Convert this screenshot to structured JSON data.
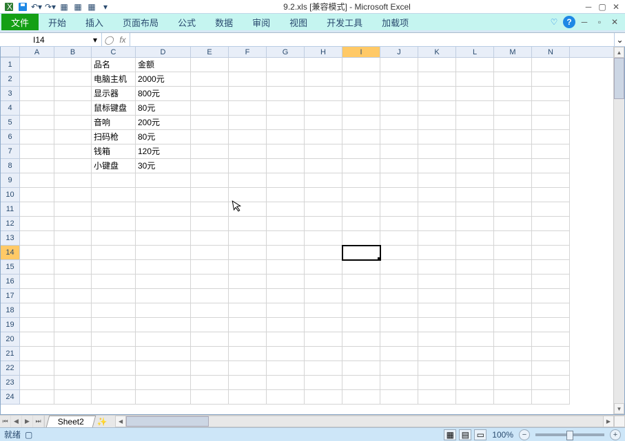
{
  "title": "9.2.xls [兼容模式] - Microsoft Excel",
  "ribbon": {
    "file": "文件",
    "tabs": [
      "开始",
      "插入",
      "页面布局",
      "公式",
      "数据",
      "审阅",
      "视图",
      "开发工具",
      "加载项"
    ]
  },
  "nameBox": "I14",
  "fxLabel": "fx",
  "formula": "",
  "columns": [
    "A",
    "B",
    "C",
    "D",
    "E",
    "F",
    "G",
    "H",
    "I",
    "J",
    "K",
    "L",
    "M",
    "N"
  ],
  "rowCount": 24,
  "activeCell": {
    "row": 14,
    "col": "I"
  },
  "cells": {
    "C1": "品名",
    "D1": "金额",
    "C2": "电脑主机",
    "D2": "2000元",
    "C3": "显示器",
    "D3": "800元",
    "C4": "鼠标键盘",
    "D4": "80元",
    "C5": "音响",
    "D5": "200元",
    "C6": "扫码枪",
    "D6": "80元",
    "C7": "钱箱",
    "D7": "120元",
    "C8": "小键盘",
    "D8": "30元"
  },
  "sheetTab": "Sheet2",
  "status": {
    "ready": "就绪",
    "macro": "▢"
  },
  "zoom": "100%"
}
